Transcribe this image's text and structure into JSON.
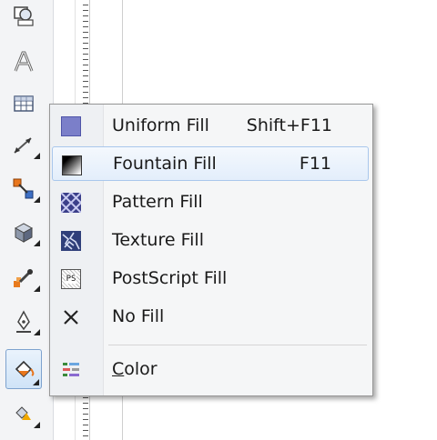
{
  "menu": {
    "items": [
      {
        "label": "Uniform Fill",
        "shortcut": "Shift+F11",
        "icon": "uniform-fill-icon",
        "color": "#7b7fc9"
      },
      {
        "label": "Fountain Fill",
        "shortcut": "F11",
        "icon": "fountain-fill-icon"
      },
      {
        "label": "Pattern Fill",
        "shortcut": "",
        "icon": "pattern-fill-icon"
      },
      {
        "label": "Texture Fill",
        "shortcut": "",
        "icon": "texture-fill-icon"
      },
      {
        "label": "PostScript Fill",
        "shortcut": "",
        "icon": "postscript-fill-icon",
        "icon_text": "PS"
      },
      {
        "label": "No Fill",
        "shortcut": "",
        "icon": "no-fill-icon"
      },
      {
        "label": "Color",
        "shortcut": "",
        "icon": "color-palette-icon"
      }
    ],
    "hovered_item": "Fountain Fill"
  },
  "toolbox": {
    "tools": [
      "shape-tool-icon",
      "text-tool-icon",
      "table-tool-icon",
      "dimension-tool-icon",
      "connector-tool-icon",
      "extrude-tool-icon",
      "eyedropper-tool-icon",
      "outline-pen-icon",
      "fill-bucket-icon",
      "interactive-fill-icon"
    ],
    "active_tool": "fill-bucket-icon"
  }
}
